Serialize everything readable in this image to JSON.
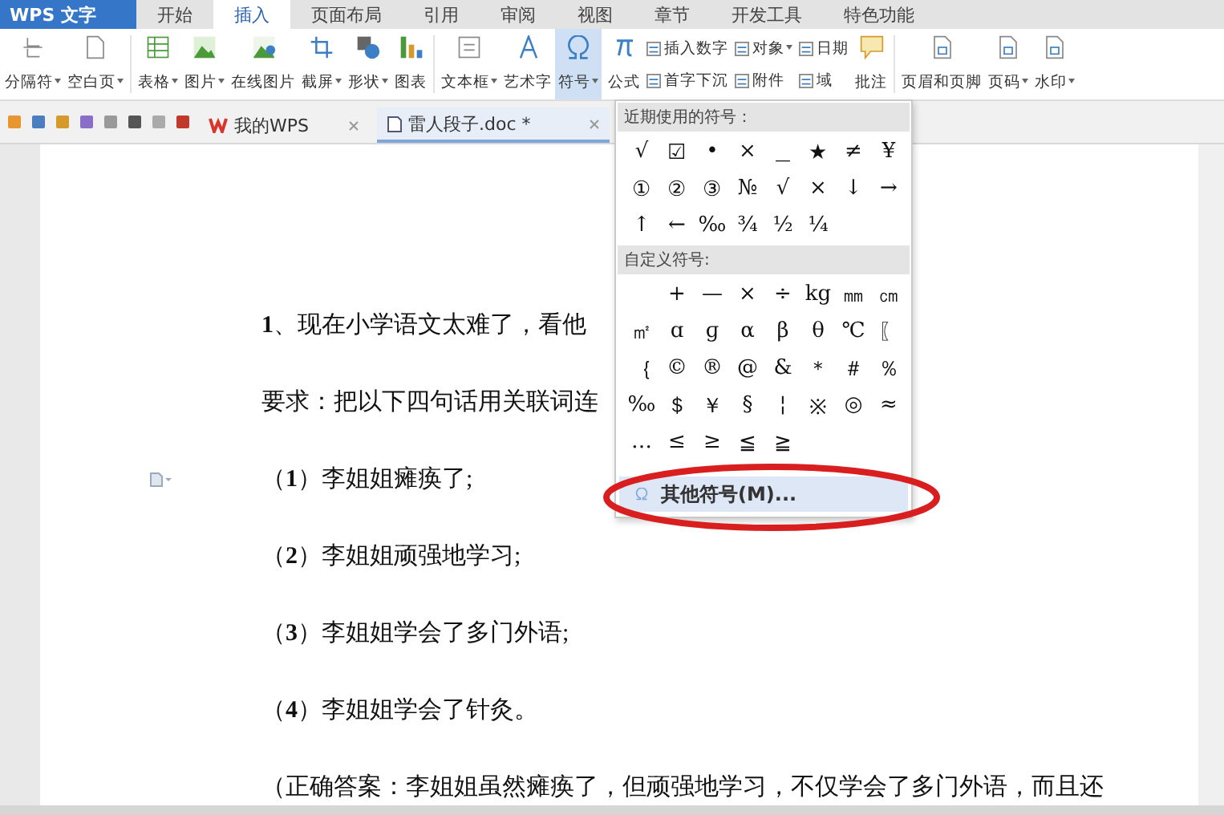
{
  "app_menu": {
    "label": "WPS 文字"
  },
  "menu_tabs": [
    {
      "label": "开始",
      "selected": false
    },
    {
      "label": "插入",
      "selected": true
    },
    {
      "label": "页面布局",
      "selected": false
    },
    {
      "label": "引用",
      "selected": false
    },
    {
      "label": "审阅",
      "selected": false
    },
    {
      "label": "视图",
      "selected": false
    },
    {
      "label": "章节",
      "selected": false
    },
    {
      "label": "开发工具",
      "selected": false
    },
    {
      "label": "特色功能",
      "selected": false
    }
  ],
  "ribbon": [
    {
      "kind": "large",
      "label": "分隔符",
      "dropdown": true,
      "selected": false
    },
    {
      "kind": "large",
      "label": "空白页",
      "dropdown": true,
      "selected": false
    },
    {
      "kind": "separator"
    },
    {
      "kind": "large",
      "label": "表格",
      "dropdown": true,
      "selected": false
    },
    {
      "kind": "large",
      "label": "图片",
      "dropdown": true,
      "selected": false
    },
    {
      "kind": "large",
      "label": "在线图片",
      "dropdown": false,
      "selected": false
    },
    {
      "kind": "large",
      "label": "截屏",
      "dropdown": true,
      "selected": false
    },
    {
      "kind": "large",
      "label": "形状",
      "dropdown": true,
      "selected": false
    },
    {
      "kind": "large",
      "label": "图表",
      "dropdown": false,
      "selected": false
    },
    {
      "kind": "separator"
    },
    {
      "kind": "large",
      "label": "文本框",
      "dropdown": true,
      "selected": false
    },
    {
      "kind": "large",
      "label": "艺术字",
      "dropdown": false,
      "selected": false
    },
    {
      "kind": "large",
      "label": "符号",
      "dropdown": true,
      "selected": true
    },
    {
      "kind": "large",
      "label": "公式",
      "dropdown": false,
      "selected": false
    },
    {
      "kind": "small",
      "items": [
        {
          "label": "插入数字",
          "dropdown": false
        },
        {
          "label": "首字下沉",
          "dropdown": false
        }
      ]
    },
    {
      "kind": "small",
      "items": [
        {
          "label": "对象",
          "dropdown": true
        },
        {
          "label": "附件",
          "dropdown": false
        }
      ]
    },
    {
      "kind": "small",
      "items": [
        {
          "label": "日期",
          "dropdown": false
        },
        {
          "label": "域",
          "dropdown": false
        }
      ]
    },
    {
      "kind": "large",
      "label": "批注",
      "dropdown": false,
      "selected": false
    },
    {
      "kind": "separator"
    },
    {
      "kind": "large",
      "label": "页眉和页脚",
      "dropdown": false,
      "selected": false
    },
    {
      "kind": "large",
      "label": "页码",
      "dropdown": true,
      "selected": false
    },
    {
      "kind": "large",
      "label": "水印",
      "dropdown": true,
      "selected": false
    }
  ],
  "doc_tabs": [
    {
      "label": "我的WPS",
      "selected": false
    },
    {
      "label": "雷人段子.doc *",
      "selected": true
    }
  ],
  "document": {
    "paragraphs": [
      "**1**、现在小学语文太难了，看他",
      "要求：把以下四句话用关联词连",
      "（**1**）李姐姐瘫痪了;",
      "（**2**）李姐姐顽强地学习;",
      "（**3**）李姐姐学会了多门外语;",
      "（**4**）李姐姐学会了针灸。",
      "（正确答案：李姐姐虽然瘫痪了，但顽强地学习，不仅学会了多门外语，而且还"
    ]
  },
  "symbol_menu": {
    "recent_title": "近期使用的符号：",
    "recent": [
      "√",
      "☑",
      "•",
      "×",
      "＿",
      "★",
      "≠",
      "¥",
      "①",
      "②",
      "③",
      "№",
      "√",
      "×",
      "↓",
      "→",
      "↑",
      "←",
      "‰",
      "¾",
      "½",
      "¼"
    ],
    "custom_title": "自定义符号:",
    "custom": [
      "+",
      "—",
      "×",
      "÷",
      "kg",
      "㎜",
      "㎝",
      "㎡",
      "ɑ",
      "ɡ",
      "α",
      "β",
      "θ",
      "℃",
      "〖",
      "｛",
      "©",
      "®",
      "@",
      "&",
      "＊",
      "＃",
      "％",
      "‰",
      "＄",
      "￥",
      "§",
      "¦",
      "※",
      "◎",
      "≈",
      "…",
      "≤",
      "≥",
      "≦",
      "≧"
    ],
    "more_button": "其他符号(M)..."
  }
}
